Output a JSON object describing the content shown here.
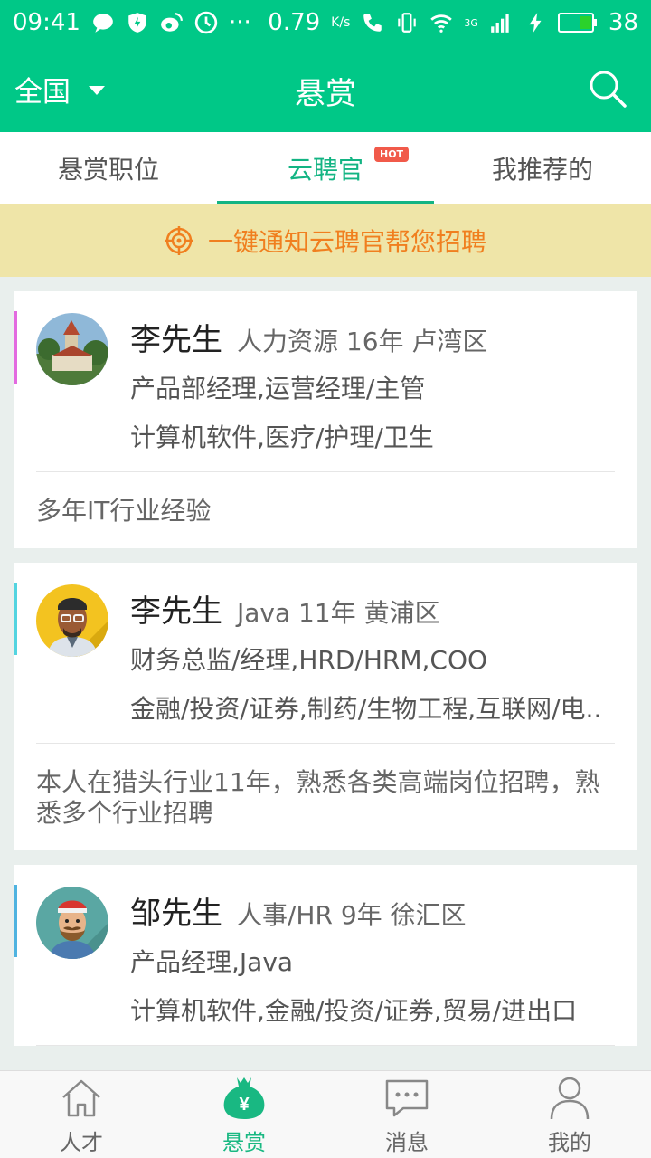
{
  "status_bar": {
    "time": "09:41",
    "speed": "0.79",
    "speed_unit": "K/s",
    "network": "3G",
    "battery": "38"
  },
  "header": {
    "region": "全国",
    "title": "悬赏"
  },
  "tabs": [
    {
      "label": "悬赏职位",
      "active": false
    },
    {
      "label": "云聘官",
      "active": true,
      "badge": "HOT"
    },
    {
      "label": "我推荐的",
      "active": false
    }
  ],
  "notice": {
    "text": "一键通知云聘官帮您招聘",
    "color": "#f07f1f"
  },
  "cards": [
    {
      "name": "李先生",
      "meta": "人力资源 16年 卢湾区",
      "line1": "产品部经理,运营经理/主管",
      "line2": "计算机软件,医疗/护理/卫生",
      "desc": "多年IT行业经验",
      "accent": "#e36ae0"
    },
    {
      "name": "李先生",
      "meta": "Java 11年 黄浦区",
      "line1": "财务总监/经理,HRD/HRM,COO",
      "line2": "金融/投资/证券,制药/生物工程,互联网/电..",
      "desc": "本人在猎头行业11年，熟悉各类高端岗位招聘，熟悉多个行业招聘",
      "accent": "#53d4e0"
    },
    {
      "name": "邹先生",
      "meta": "人事/HR 9年 徐汇区",
      "line1": "产品经理,Java",
      "line2": "计算机软件,金融/投资/证券,贸易/进出口",
      "desc": "",
      "accent": "#4fb3e0"
    }
  ],
  "bottom_nav": [
    {
      "label": "人才",
      "icon": "house-icon",
      "active": false
    },
    {
      "label": "悬赏",
      "icon": "money-bag-icon",
      "active": true
    },
    {
      "label": "消息",
      "icon": "chat-bubble-icon",
      "active": false
    },
    {
      "label": "我的",
      "icon": "person-icon",
      "active": false
    }
  ],
  "colors": {
    "brand": "#00c887",
    "active_tab": "#13b483"
  }
}
